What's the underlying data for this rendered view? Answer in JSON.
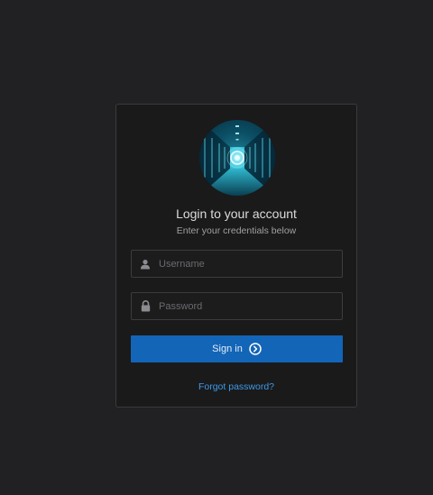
{
  "login": {
    "title": "Login to your account",
    "subtitle": "Enter your credentials below",
    "username_placeholder": "Username",
    "password_placeholder": "Password",
    "signin_label": "Sign in",
    "forgot_label": "Forgot password?"
  },
  "icons": {
    "logo": "server-room-image",
    "username": "user-icon",
    "password": "lock-icon",
    "signin": "arrow-circle-right-icon"
  },
  "colors": {
    "background": "#212123",
    "card": "#1a1a1b",
    "primary_button": "#1365b8",
    "link": "#3d9ae8"
  }
}
